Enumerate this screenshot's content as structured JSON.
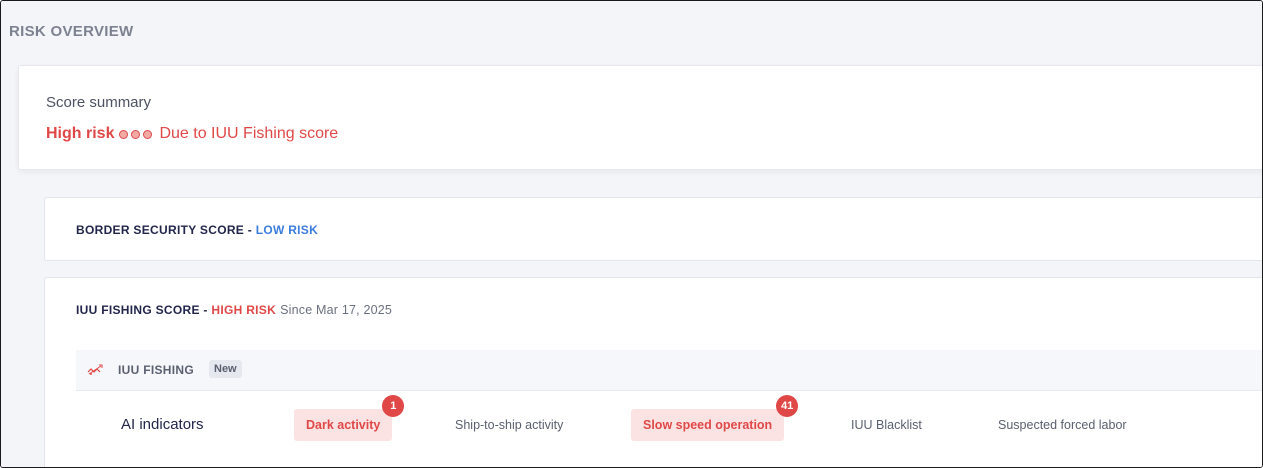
{
  "section": {
    "title": "RISK OVERVIEW"
  },
  "summary": {
    "label": "Score summary",
    "risk_level": "High risk",
    "reason": "Due to IUU Fishing score",
    "risk_dots": 3
  },
  "border_security": {
    "title": "BORDER SECURITY SCORE",
    "separator": " - ",
    "risk": "LOW RISK"
  },
  "iuu_score": {
    "title": "IUU FISHING SCORE",
    "separator": " - ",
    "risk": "HIGH RISK",
    "since": "Since Mar 17, 2025"
  },
  "iuu_panel": {
    "icon": "fish-icon",
    "title": "IUU FISHING",
    "badge": "New"
  },
  "ai_indicators": {
    "label": "AI indicators",
    "items": [
      {
        "label": "Dark activity",
        "active": true,
        "count": "1"
      },
      {
        "label": "Ship-to-ship activity",
        "active": false
      },
      {
        "label": "Slow speed operation",
        "active": true,
        "count": "41"
      },
      {
        "label": "IUU Blacklist",
        "active": false
      },
      {
        "label": "Suspected forced labor",
        "active": false
      }
    ]
  },
  "colors": {
    "high_risk": "#e04848",
    "low_risk": "#3b7ddd",
    "navy": "#22264a"
  }
}
